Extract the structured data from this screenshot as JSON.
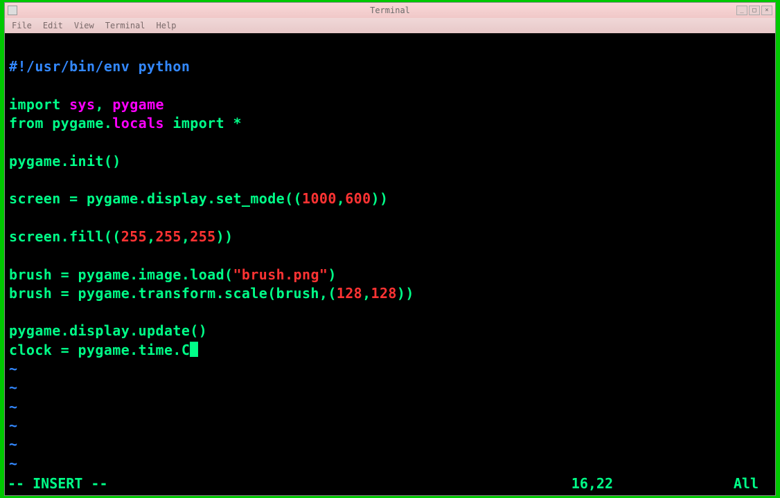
{
  "window": {
    "title": "Terminal"
  },
  "menubar": {
    "items": [
      "File",
      "Edit",
      "View",
      "Terminal",
      "Help"
    ]
  },
  "code": {
    "line1_shebang": "#!/usr/bin/env python",
    "line3_import": "import",
    "line3_sys": "sys",
    "line3_comma": ", ",
    "line3_pygame": "pygame",
    "line4_from": "from",
    "line4_pygame": "pygame.",
    "line4_locals": "locals",
    "line4_import": "import",
    "line4_star": "*",
    "line6": "pygame.init()",
    "line8_a": "screen = pygame.display.set_mode((",
    "line8_n1": "1000",
    "line8_c": ",",
    "line8_n2": "600",
    "line8_b": "))",
    "line10_a": "screen.fill((",
    "line10_n1": "255",
    "line10_c1": ",",
    "line10_n2": "255",
    "line10_c2": ",",
    "line10_n3": "255",
    "line10_b": "))",
    "line12_a": "brush = pygame.image.load(",
    "line12_s": "\"brush.png\"",
    "line12_b": ")",
    "line13_a": "brush = pygame.transform.scale(brush,(",
    "line13_n1": "128",
    "line13_c": ",",
    "line13_n2": "128",
    "line13_b": "))",
    "line15": "pygame.display.update()",
    "line16": "clock = pygame.time.C",
    "tilde": "~"
  },
  "status": {
    "mode": "-- INSERT --",
    "position": "16,22",
    "percent": "All"
  }
}
